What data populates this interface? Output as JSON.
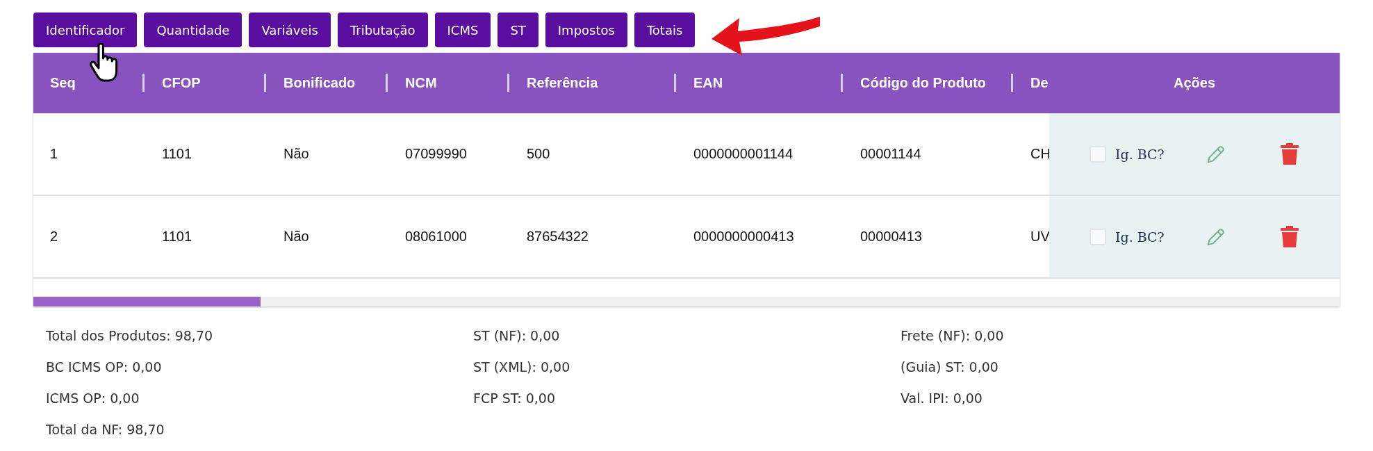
{
  "tabs": [
    "Identificador",
    "Quantidade",
    "Variáveis",
    "Tributação",
    "ICMS",
    "ST",
    "Impostos",
    "Totais"
  ],
  "table": {
    "columns": [
      "Seq",
      "CFOP",
      "Bonificado",
      "NCM",
      "Referência",
      "EAN",
      "Código do Produto",
      "De"
    ],
    "actions_header": "Ações",
    "rows": [
      {
        "cells": [
          "1",
          "1101",
          "Não",
          "07099990",
          "500",
          "0000000001144",
          "00001144",
          "CH"
        ],
        "ignore_bc": {
          "label": "Ig. BC?",
          "checked": false
        }
      },
      {
        "cells": [
          "2",
          "1101",
          "Não",
          "08061000",
          "87654322",
          "0000000000413",
          "00000413",
          "UV"
        ],
        "ignore_bc": {
          "label": "Ig. BC?",
          "checked": false
        }
      }
    ]
  },
  "totals": [
    [
      "Total dos Produtos: 98,70",
      "BC ICMS OP: 0,00",
      "ICMS OP: 0,00",
      "Total da NF: 98,70"
    ],
    [
      "ST (NF): 0,00",
      "ST (XML): 0,00",
      "FCP ST: 0,00"
    ],
    [
      "Frete (NF): 0,00",
      "(Guia) ST: 0,00",
      "Val. IPI: 0,00"
    ]
  ]
}
